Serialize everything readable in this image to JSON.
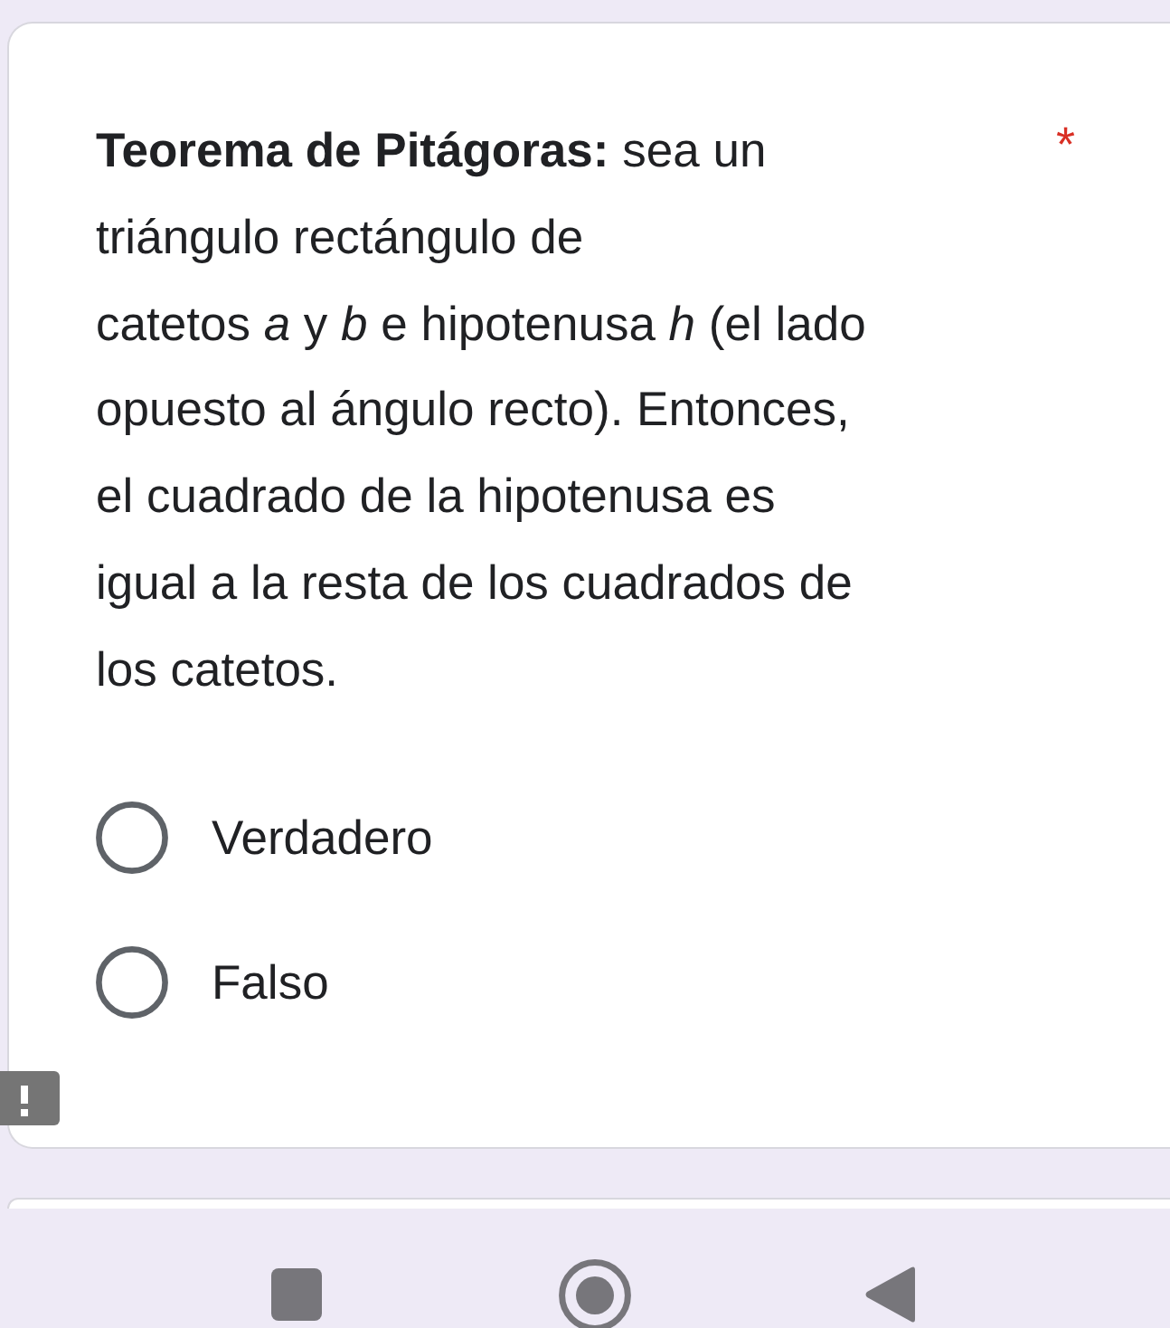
{
  "question": {
    "text": "**Teorema de Pitágoras:** sea un\ntriángulo rectángulo de\ncatetos *a* y *b* e hipotenusa *h* (el lado\nopuesto al ángulo recto). Entonces,\nel cuadrado de la hipotenusa es\nigual a la resta de los cuadrados de\nlos catetos.",
    "required_mark": "*"
  },
  "options": [
    {
      "label": "Verdadero",
      "selected": false
    },
    {
      "label": "Falso",
      "selected": false
    }
  ]
}
